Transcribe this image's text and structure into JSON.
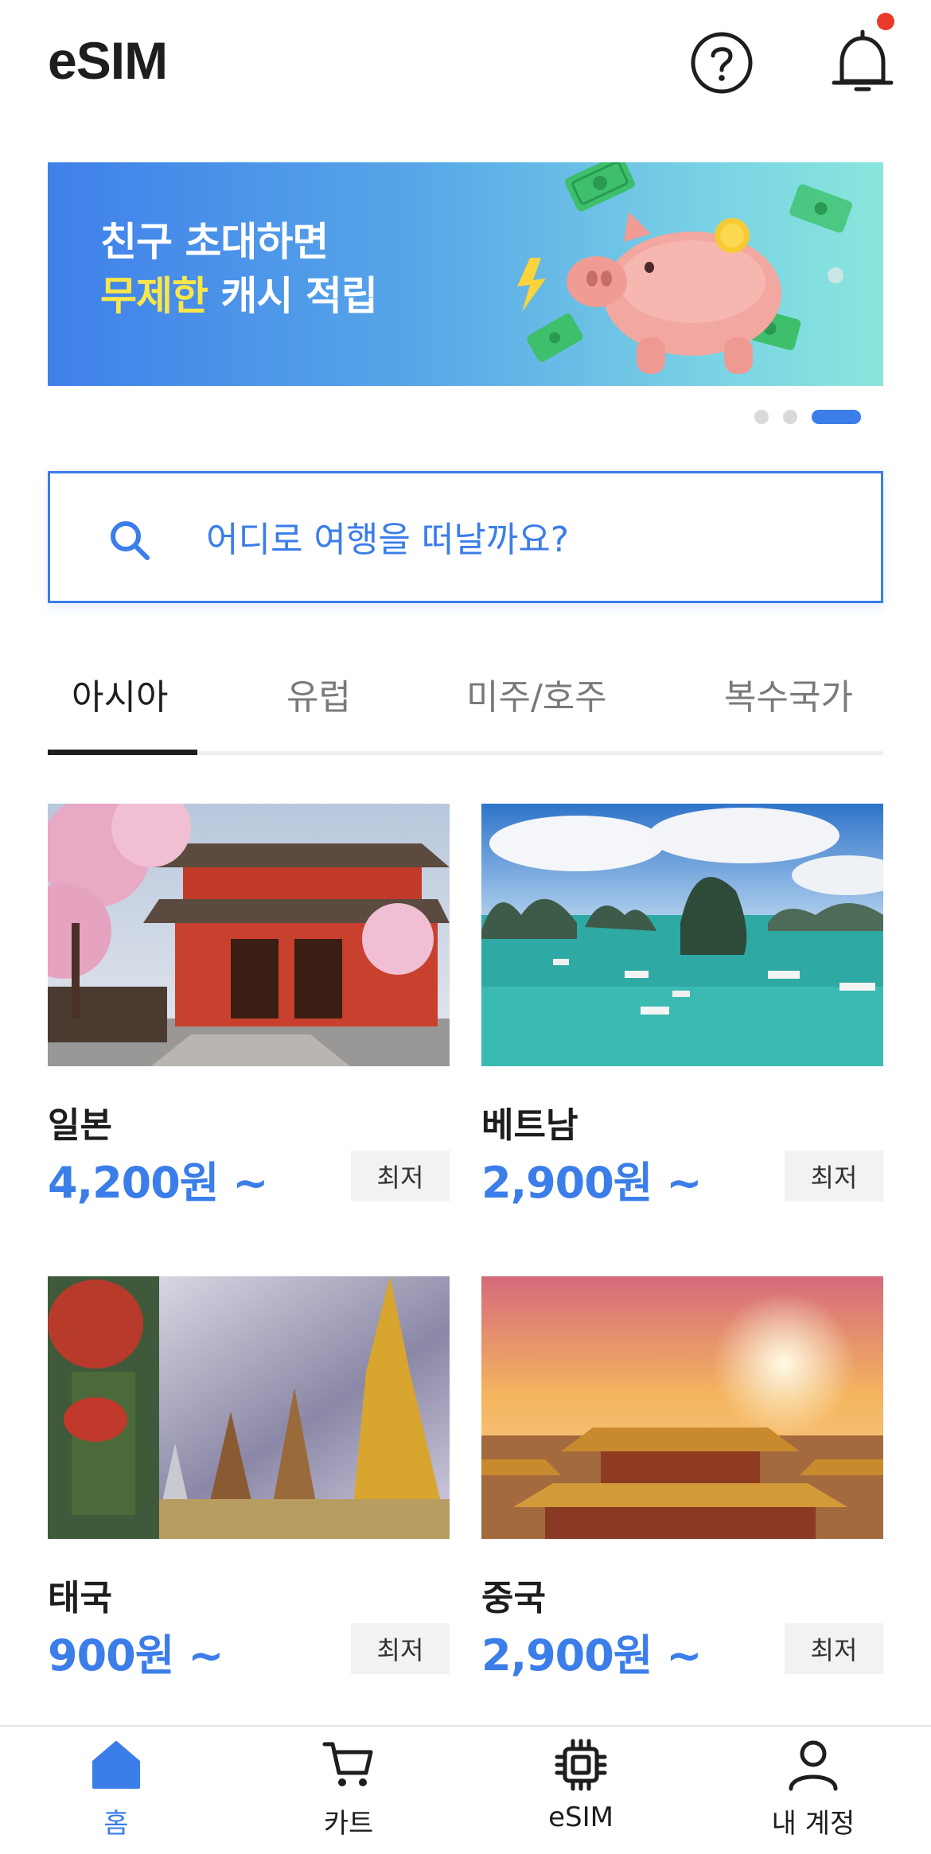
{
  "header": {
    "title": "eSIM",
    "help_icon": "help-circle-icon",
    "bell_icon": "bell-icon",
    "has_notification": true
  },
  "banner": {
    "line1": "친구 초대하면",
    "line2_highlight": "무제한",
    "line2_rest": " 캐시 적립",
    "art_icon": "piggy-bank-icon",
    "slide_current": 3,
    "slide_total": 3
  },
  "search": {
    "placeholder": "어디로 여행을 떠날까요?"
  },
  "tabs": [
    {
      "label": "아시아",
      "active": true
    },
    {
      "label": "유럽",
      "active": false
    },
    {
      "label": "미주/호주",
      "active": false
    },
    {
      "label": "복수국가",
      "active": false
    }
  ],
  "destinations": [
    {
      "name": "일본",
      "price": "4,200원 ~",
      "badge": "최저"
    },
    {
      "name": "베트남",
      "price": "2,900원 ~",
      "badge": "최저"
    },
    {
      "name": "태국",
      "price": "900원 ~",
      "badge": "최저"
    },
    {
      "name": "중국",
      "price": "2,900원 ~",
      "badge": "최저"
    }
  ],
  "bottom_nav": [
    {
      "label": "홈",
      "icon": "home-icon",
      "active": true
    },
    {
      "label": "카트",
      "icon": "cart-icon",
      "active": false
    },
    {
      "label": "eSIM",
      "icon": "chip-icon",
      "active": false
    },
    {
      "label": "내 계정",
      "icon": "user-icon",
      "active": false
    }
  ],
  "colors": {
    "accent": "#3b7de9",
    "banner_highlight": "#fbe64a",
    "notification_dot": "#ea3a2c"
  }
}
